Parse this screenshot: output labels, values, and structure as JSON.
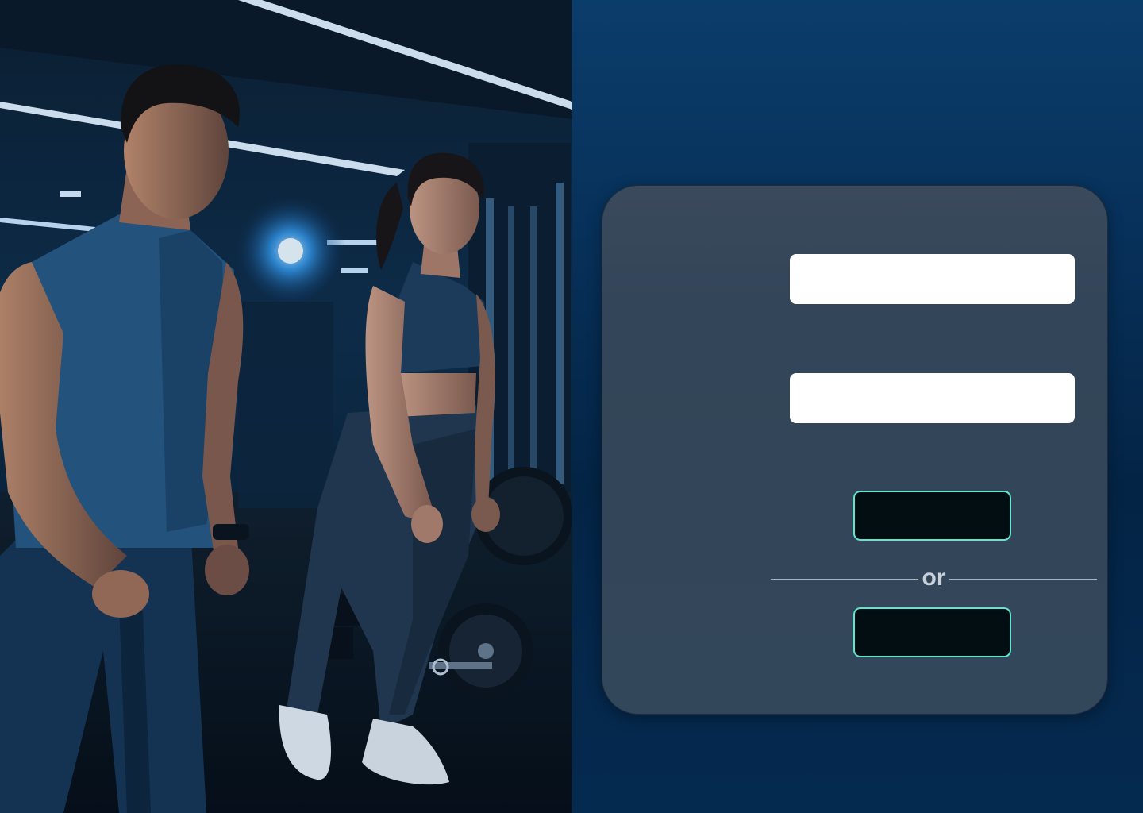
{
  "login": {
    "username_placeholder": "",
    "password_placeholder": "",
    "primary_button_label": "",
    "alt_button_label": "",
    "divider_text": "or"
  },
  "hero": {
    "subject": "gym-photo"
  },
  "colors": {
    "panel_background": "#06274a",
    "card_background": "#33475a",
    "button_fill": "#020e12",
    "button_border": "#5ee6cf",
    "field_background": "#ffffff"
  }
}
